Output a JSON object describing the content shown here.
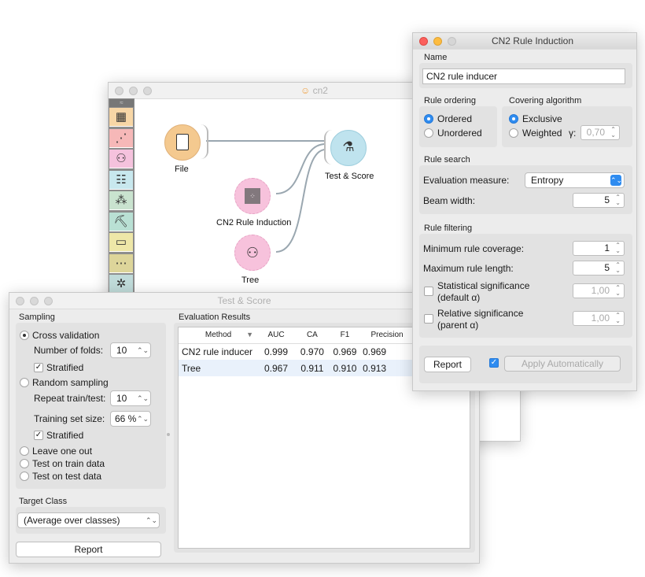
{
  "canvas": {
    "title": "cn2",
    "nodes": {
      "file": "File",
      "cn2": "CN2 Rule Induction",
      "tree": "Tree",
      "test_score": "Test & Score"
    },
    "toolbox": [
      {
        "icon": "data-icon",
        "color": "#f7d6a6",
        "glyph": "▦"
      },
      {
        "icon": "visualize-icon",
        "color": "#f6b8b8",
        "glyph": "⋰"
      },
      {
        "icon": "model-icon",
        "color": "#f5c2dd",
        "glyph": "⚇"
      },
      {
        "icon": "evaluate-icon",
        "color": "#c8e8ee",
        "glyph": "☷"
      },
      {
        "icon": "unsupervised-icon",
        "color": "#c9e3cf",
        "glyph": "⁂"
      },
      {
        "icon": "associate-icon",
        "color": "#b9e0d4",
        "glyph": "⛏"
      },
      {
        "icon": "image-icon",
        "color": "#eee7a8",
        "glyph": "▭"
      },
      {
        "icon": "timeseries-icon",
        "color": "#ddd59a",
        "glyph": "⋯"
      },
      {
        "icon": "network-icon",
        "color": "#c0dbda",
        "glyph": "✲"
      }
    ]
  },
  "cn2_window": {
    "title": "CN2 Rule Induction",
    "name_section": "Name",
    "name_value": "CN2 rule inducer",
    "rule_ordering": {
      "label": "Rule ordering",
      "options": [
        "Ordered",
        "Unordered"
      ],
      "selected": "Ordered"
    },
    "covering": {
      "label": "Covering algorithm",
      "options": [
        "Exclusive",
        "Weighted"
      ],
      "selected": "Exclusive",
      "gamma_label": "γ:",
      "gamma_value": "0,70"
    },
    "rule_search": {
      "label": "Rule search",
      "eval_label": "Evaluation measure:",
      "eval_value": "Entropy",
      "beam_label": "Beam width:",
      "beam_value": "5"
    },
    "rule_filtering": {
      "label": "Rule filtering",
      "min_cov_label": "Minimum rule coverage:",
      "min_cov_value": "1",
      "max_len_label": "Maximum rule length:",
      "max_len_value": "5",
      "stat_sig_label_1": "Statistical significance",
      "stat_sig_label_2": "(default α)",
      "stat_sig_value": "1,00",
      "rel_sig_label_1": "Relative significance",
      "rel_sig_label_2": "(parent α)",
      "rel_sig_value": "1,00"
    },
    "report_label": "Report",
    "apply_label": "Apply Automatically",
    "apply_checked": true
  },
  "test_window": {
    "title": "Test & Score",
    "sampling_label": "Sampling",
    "cross_validation": "Cross validation",
    "folds_label": "Number of folds:",
    "folds_value": "10",
    "stratified_1": "Stratified",
    "random_sampling": "Random sampling",
    "repeat_label": "Repeat train/test:",
    "repeat_value": "10",
    "train_size_label": "Training set size:",
    "train_size_value": "66 %",
    "stratified_2": "Stratified",
    "leave_one_out": "Leave one out",
    "train_data": "Test on train data",
    "test_data": "Test on test data",
    "target_label": "Target Class",
    "target_value": "(Average over classes)",
    "report_label": "Report",
    "results_label": "Evaluation Results",
    "columns": [
      "Method",
      "AUC",
      "CA",
      "F1",
      "Precision"
    ],
    "rows": [
      [
        "CN2 rule inducer",
        "0.999",
        "0.970",
        "0.969",
        "0.969"
      ],
      [
        "Tree",
        "0.967",
        "0.911",
        "0.910",
        "0.913"
      ]
    ]
  }
}
